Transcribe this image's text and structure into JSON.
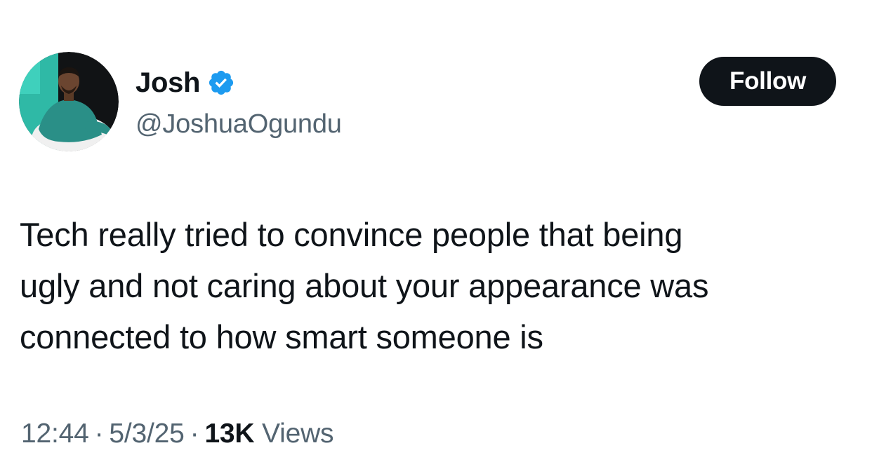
{
  "author": {
    "display_name": "Josh",
    "handle": "@JoshuaOgundu",
    "verified": true,
    "verified_color": "#1d9bf0",
    "avatar_icon": "profile-photo"
  },
  "follow_button": {
    "label": "Follow",
    "background": "#0f1419",
    "text_color": "#ffffff"
  },
  "tweet": {
    "lines": [
      "Tech really tried to convince people that being",
      "ugly and not caring about your appearance was",
      "connected to how smart someone is"
    ]
  },
  "meta": {
    "time": "12:44",
    "separator": "·",
    "date": "5/3/25",
    "views_count": "13K",
    "views_label": "Views"
  },
  "colors": {
    "text_primary": "#0f1419",
    "text_secondary": "#536471"
  }
}
